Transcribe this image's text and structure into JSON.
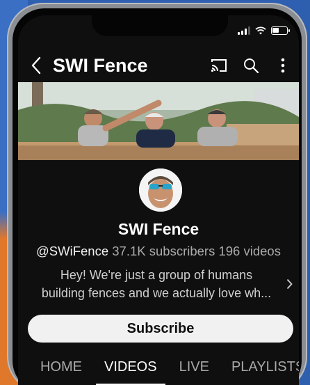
{
  "app": {
    "title": "SWI Fence"
  },
  "status_bar": {
    "wifi": "wifi-icon",
    "signal": "signal-icon",
    "battery": "battery-icon"
  },
  "header": {
    "back_icon": "back-arrow-icon",
    "title": "SWI Fence",
    "cast_icon": "cast-icon",
    "search_icon": "search-icon",
    "more_icon": "more-vertical-icon"
  },
  "channel": {
    "name": "SWI Fence",
    "handle": "@SWiFence",
    "subscribers": "37.1K subscribers",
    "videos": "196 videos",
    "description_line1": "Hey! We're just a group of humans",
    "description_line2": "building fences and we actually love wh...",
    "subscribe_label": "Subscribe"
  },
  "tabs": [
    {
      "label": "HOME",
      "active": false
    },
    {
      "label": "VIDEOS",
      "active": true
    },
    {
      "label": "LIVE",
      "active": false
    },
    {
      "label": "PLAYLISTS",
      "active": false
    }
  ],
  "colors": {
    "background": "#0f0f0f",
    "text": "#ffffff",
    "muted": "#aaaaaa",
    "button": "#f1f1f1"
  }
}
